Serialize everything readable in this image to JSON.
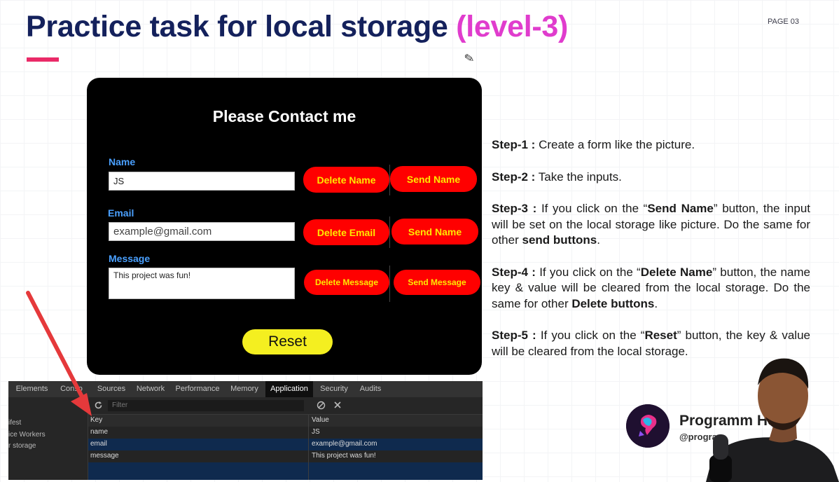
{
  "slide": {
    "title_main": "Practice task for local storage",
    "title_accent": "(level-3)",
    "page_label": "PAGE 03"
  },
  "form": {
    "heading": "Please Contact me",
    "name_label": "Name",
    "name_value": "JS",
    "email_label": "Email",
    "email_placeholder": "example@gmail.com",
    "message_label": "Message",
    "message_value": "This project was fun!",
    "delete_name": "Delete Name",
    "send_name": "Send Name",
    "delete_email": "Delete Email",
    "send_email": "Send Name",
    "delete_message": "Delete Message",
    "send_message": "Send Message",
    "reset": "Reset"
  },
  "steps": [
    {
      "label": "Step-1 :",
      "text": " Create a form like the picture."
    },
    {
      "label": "Step-2 :",
      "text": " Take the inputs."
    },
    {
      "label": "Step-3 :",
      "pre": " If you click on the “",
      "b1": "Send Name",
      "mid": "” button, the input will be set on the local storage like picture. Do the same for other ",
      "b2": "send buttons",
      "post": "."
    },
    {
      "label": "Step-4 :",
      "pre": " If you click on the “",
      "b1": "Delete Name",
      "mid": "” button, the name key & value will be cleared from the local storage. Do the same for other ",
      "b2": "Delete buttons",
      "post": "."
    },
    {
      "label": "Step-5 :",
      "pre": " If you click on the “",
      "b1": "Reset",
      "mid": "” button, the key & value will be cleared from the local storage."
    }
  ],
  "devtools": {
    "tabs": [
      "Elements",
      "Conso",
      "Sources",
      "Network",
      "Performance",
      "Memory",
      "Application",
      "Security",
      "Audits"
    ],
    "active_tab": "Application",
    "sidebar": [
      "ifest",
      "ice Workers",
      "r storage"
    ],
    "filter_placeholder": "Filter",
    "columns": {
      "key": "Key",
      "value": "Value"
    },
    "rows": [
      {
        "key": "name",
        "value": "JS"
      },
      {
        "key": "email",
        "value": "example@gmail.com"
      },
      {
        "key": "message",
        "value": "This project was fun!"
      }
    ]
  },
  "brand": {
    "name": "Programm     Hero",
    "handle": "@program"
  },
  "colors": {
    "title": "#14215c",
    "accent": "#e03ccd",
    "button_red": "#ff0000",
    "button_text": "#ffe800",
    "reset_yellow": "#f4ef20",
    "label_blue": "#4aa0ff",
    "arrow": "#e5393b"
  }
}
